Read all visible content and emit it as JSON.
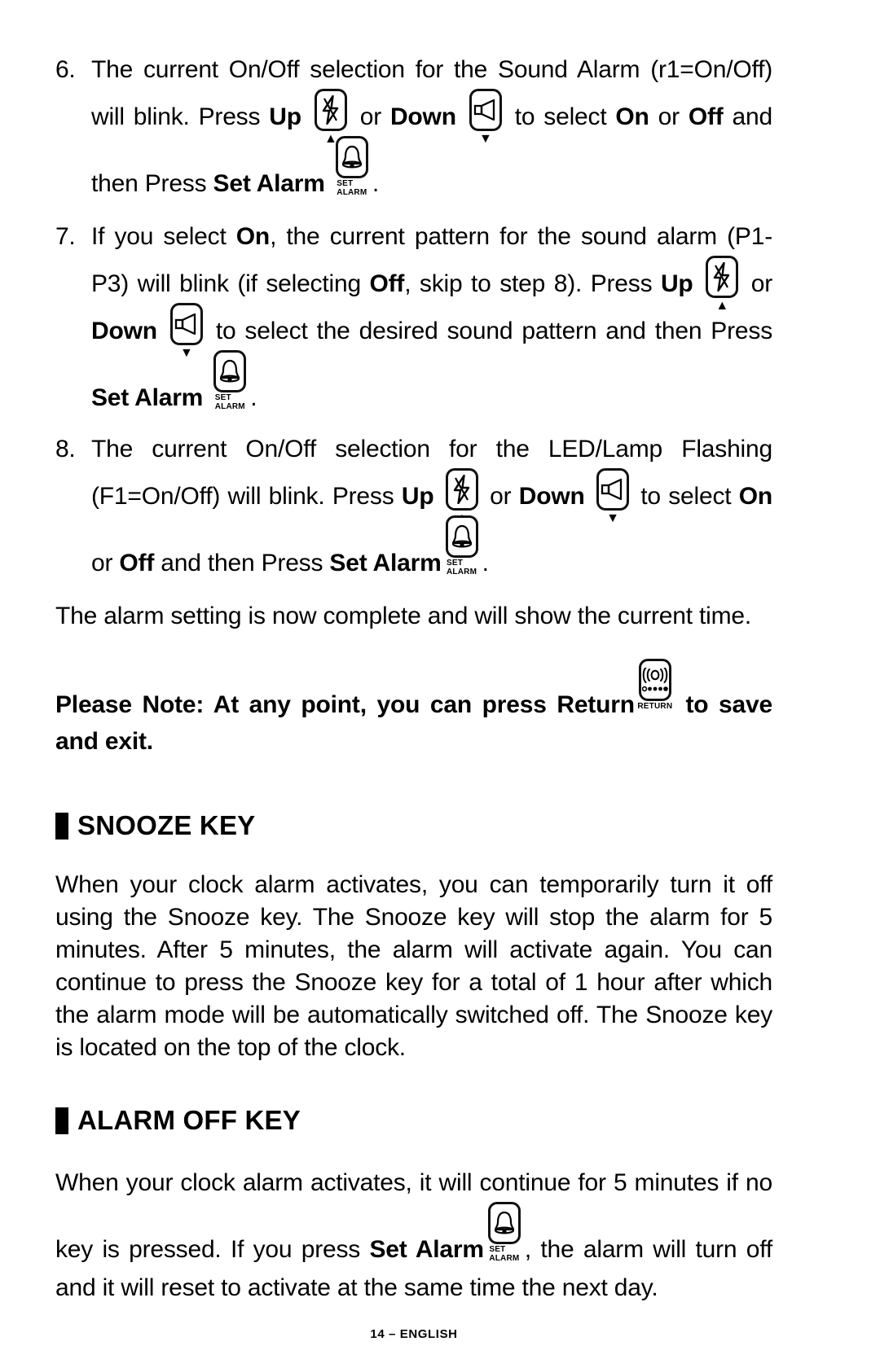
{
  "document": {
    "footer": "14 – ENGLISH",
    "page_number": "14",
    "language": "ENGLISH"
  },
  "icons": {
    "up": {
      "name": "up-button-icon",
      "glyph": "lightning-bolt",
      "marker": "▲"
    },
    "down": {
      "name": "down-button-icon",
      "glyph": "speaker",
      "marker": "▼"
    },
    "set_alarm": {
      "name": "set-alarm-button-icon",
      "glyph": "bell",
      "caption_line1": "SET",
      "caption_line2": "ALARM"
    },
    "return": {
      "name": "return-button-icon",
      "glyph": "radio-wave",
      "caption_line1": "RETURN"
    }
  },
  "steps": [
    {
      "number": "6.",
      "t1": "The current On/Off selection for the Sound Alarm (r1=On/Off) will blink. Press ",
      "up_label": "Up",
      "t2": " or ",
      "down_label": "Down",
      "t3": " to select ",
      "on_label": "On",
      "t4": " or ",
      "off_label": "Off",
      "t5": " and then Press ",
      "set_alarm_label": "Set Alarm",
      "t6": "."
    },
    {
      "number": "7.",
      "t1": "If you select ",
      "on_label": "On",
      "t2": ", the current pattern for the sound alarm (P1-P3) will blink (if selecting ",
      "off_label": "Off",
      "t3": ", skip to step 8). Press ",
      "up_label": "Up",
      "t4": " or ",
      "down_label": "Down",
      "t5": " to select the desired sound pattern and then Press ",
      "set_alarm_label": "Set Alarm",
      "t6": "."
    },
    {
      "number": "8.",
      "t1": "The current On/Off selection for the LED/Lamp Flashing (F1=On/Off) will blink. Press ",
      "up_label": "Up",
      "t2": " or ",
      "down_label": "Down",
      "t3": " to select ",
      "on_label": "On",
      "t4": " or ",
      "off_label": "Off",
      "t5": " and then Press ",
      "set_alarm_label": "Set Alarm",
      "t6": "."
    }
  ],
  "completion_paragraph": "The alarm setting is now complete and will show the current time.",
  "note": {
    "prefix_bold": "Please Note",
    "t1": ": At any point, you can press Return",
    "t2": " to save and exit."
  },
  "sections": [
    {
      "heading": "SNOOZE KEY",
      "body": "When your clock alarm activates, you can temporarily turn it off using the Snooze key. The Snooze key will stop the alarm for 5 minutes. After 5 minutes, the alarm will activate again. You can continue to press the Snooze key for a total of 1 hour after which the alarm mode will be automatically switched off. The Snooze key is located on the top of the clock."
    },
    {
      "heading": "ALARM OFF KEY",
      "body_t1": "When your clock alarm activates, it will continue for 5 minutes if no key is pressed. If you press ",
      "body_set_alarm": "Set Alarm",
      "body_t2": ", the alarm will turn off and it will reset to activate at the same time the next day."
    }
  ]
}
